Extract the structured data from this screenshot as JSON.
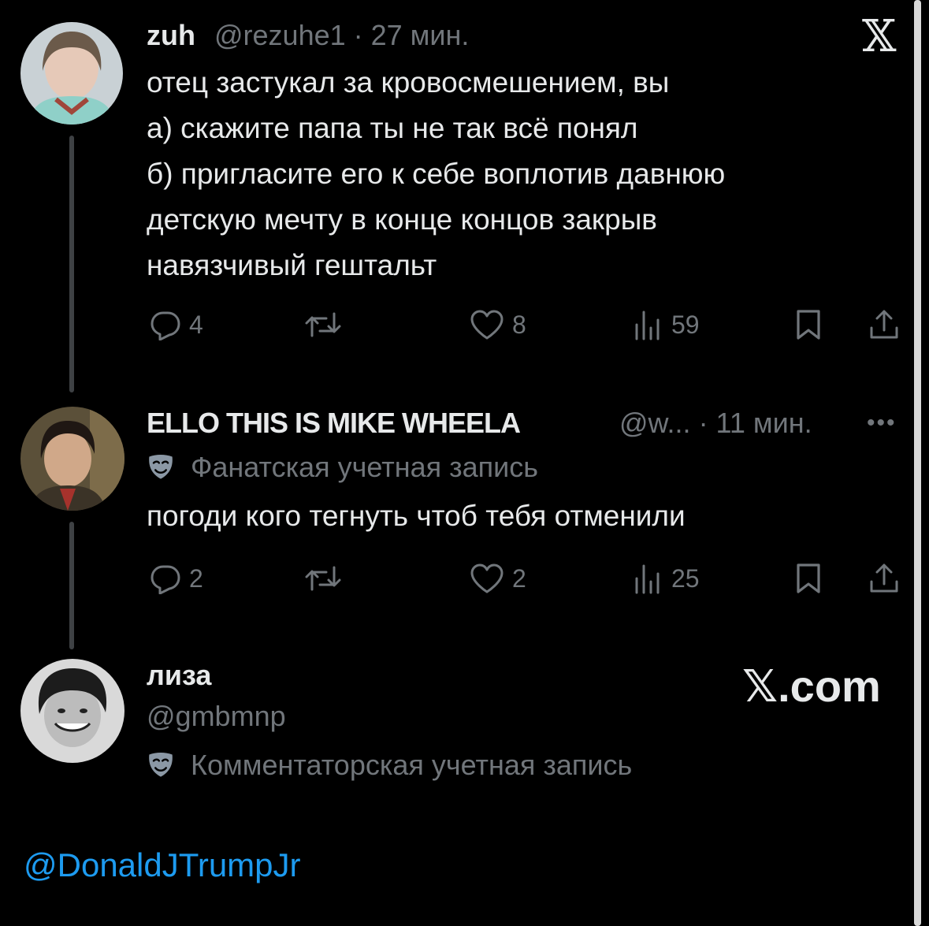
{
  "brand": {
    "x_logo": "𝕏",
    "footer_brand": "𝕏.com"
  },
  "tweet1": {
    "name": "zuh",
    "handle_time": "@rezuhe1 · 27 мин.",
    "lines": [
      "отец застукал за кровосмешением, вы",
      "а) скажите папа ты не так всё понял",
      "б) пригласите его к себе воплотив давнюю",
      "детскую мечту в конце концов закрыв",
      "навязчивый гештальт"
    ],
    "replies": "4",
    "likes": "8",
    "views": "59"
  },
  "tweet2": {
    "name": "ELLO THIS IS MIKE WHEELA",
    "handle_time": "@w... · 11 мин.",
    "more": "•••",
    "label": "Фанатская учетная запись",
    "text": "погоди кого тегнуть чтоб тебя отменили",
    "replies": "2",
    "likes": "2",
    "views": "25"
  },
  "reply": {
    "name": "лиза",
    "handle": "@gmbmnp",
    "label": "Комментаторская учетная запись"
  },
  "mention": "@DonaldJTrumpJr",
  "colors": {
    "background": "#000000",
    "text": "#e7e9ea",
    "secondary": "#71767b",
    "link": "#1d9bf0",
    "mask_badge": "#8b98a5"
  },
  "icons": {
    "reply": "reply-icon",
    "retweet": "retweet-icon",
    "like": "like-icon",
    "views": "views-icon",
    "bookmark": "bookmark-icon",
    "share": "share-icon",
    "mask": "mask-icon"
  }
}
